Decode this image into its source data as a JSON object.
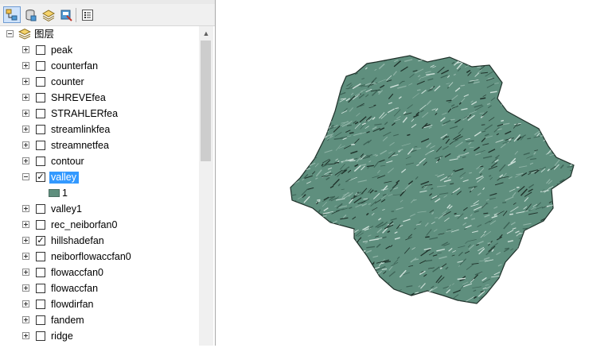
{
  "toc": {
    "toolbar": {
      "buttons": [
        {
          "icon": "list-by-drawing-order-icon"
        },
        {
          "icon": "list-by-source-icon"
        },
        {
          "icon": "list-by-visibility-icon"
        },
        {
          "icon": "list-by-selection-icon"
        },
        {
          "icon": "options-icon"
        }
      ]
    },
    "root": {
      "label": "图层"
    },
    "layers": [
      {
        "label": "peak",
        "checked": false
      },
      {
        "label": "counterfan",
        "checked": false
      },
      {
        "label": "counter",
        "checked": false
      },
      {
        "label": "SHREVEfea",
        "checked": false
      },
      {
        "label": "STRAHLERfea",
        "checked": false
      },
      {
        "label": "streamlinkfea",
        "checked": false
      },
      {
        "label": "streamnetfea",
        "checked": false
      },
      {
        "label": "contour",
        "checked": false
      },
      {
        "label": "valley",
        "checked": true,
        "expanded": true,
        "selected": true
      },
      {
        "label": "1",
        "legend": true
      },
      {
        "label": "valley1",
        "checked": false
      },
      {
        "label": "rec_neiborfan0",
        "checked": false
      },
      {
        "label": "hillshadefan",
        "checked": true
      },
      {
        "label": "neiborflowaccfan0",
        "checked": false
      },
      {
        "label": "flowaccfan0",
        "checked": false
      },
      {
        "label": "flowaccfan",
        "checked": false
      },
      {
        "label": "flowdirfan",
        "checked": false
      },
      {
        "label": "fandem",
        "checked": false
      },
      {
        "label": "ridge",
        "checked": false
      }
    ],
    "check_mark": "✓"
  },
  "map": {
    "fill_color": "#5f8f7e",
    "highlight_color": "#cfe1da",
    "shadow_color": "#1e3029"
  }
}
